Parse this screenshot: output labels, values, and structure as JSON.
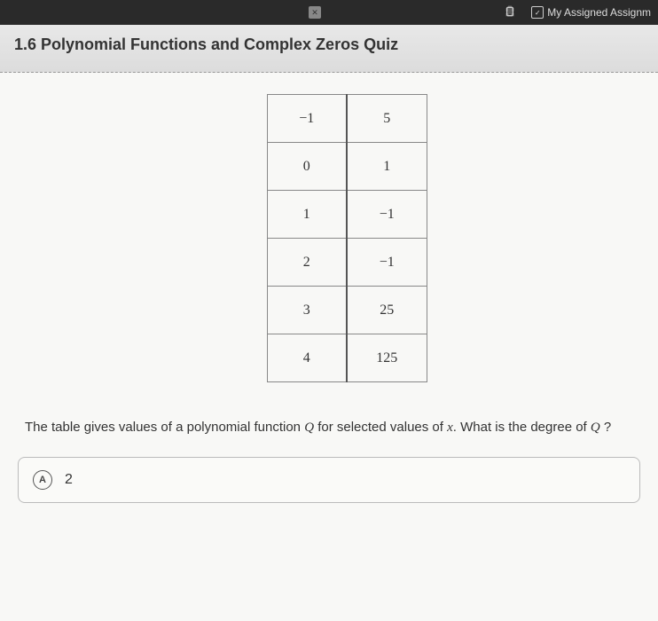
{
  "nav": {
    "assigned_label": "My Assigned Assignm"
  },
  "header": {
    "title": "1.6 Polynomial Functions and Complex Zeros Quiz"
  },
  "chart_data": {
    "type": "table",
    "rows": [
      {
        "x": "−1",
        "q": "5"
      },
      {
        "x": "0",
        "q": "1"
      },
      {
        "x": "1",
        "q": "−1"
      },
      {
        "x": "2",
        "q": "−1"
      },
      {
        "x": "3",
        "q": "25"
      },
      {
        "x": "4",
        "q": "125"
      }
    ]
  },
  "question": {
    "prefix": "The table gives values of a polynomial function ",
    "fn": "Q",
    "mid": " for selected values of ",
    "var": "x",
    "suffix": ". What is the degree of ",
    "fn2": "Q",
    "end": " ?"
  },
  "option": {
    "letter": "A",
    "value": "2"
  }
}
